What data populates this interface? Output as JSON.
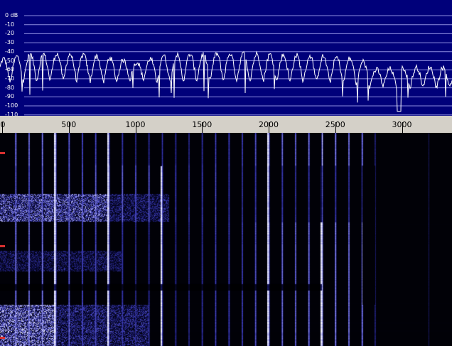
{
  "window": {
    "title": ""
  },
  "spectrum": {
    "db_labels": [
      "0 dB",
      "-10",
      "-20",
      "-30",
      "-40",
      "-50",
      "-60",
      "-70",
      "-80",
      "-90",
      "-100",
      "-110"
    ],
    "grid_color": "#8c8ce0",
    "background": "#00007a",
    "trace_color": "#ffffff"
  },
  "ruler": {
    "labels": [
      "0",
      "500",
      "1000",
      "1500",
      "2000",
      "2500",
      "3000"
    ],
    "background": "#d4d0c8"
  },
  "waterfall": {
    "palette": [
      "#000000",
      "#0a0a40",
      "#3c3cb4",
      "#9c9cf0",
      "#ffffff"
    ],
    "marker_color": "#d83030",
    "strong_lines_hz": [
      390,
      790,
      1190,
      1990,
      2390
    ],
    "segments": [
      "segment-1",
      "segment-2",
      "segment-3"
    ]
  },
  "chart_data": {
    "type": "line",
    "title": "",
    "xlabel": "",
    "ylabel": "",
    "xlim": [
      0,
      3400
    ],
    "ylim": [
      -110,
      0
    ],
    "x_ticks": [
      0,
      500,
      1000,
      1500,
      2000,
      2500,
      3000
    ],
    "y_ticks": [
      0,
      -10,
      -20,
      -30,
      -40,
      -50,
      -60,
      -70,
      -80,
      -90,
      -100,
      -110
    ],
    "grid": true,
    "series": [
      {
        "x": [
          0,
          200,
          400,
          600,
          800,
          1000,
          1200,
          1400,
          1600,
          1800,
          2000,
          2200,
          2400,
          2600,
          2750,
          2800,
          3000,
          3200,
          3400
        ],
        "y_peaks": [
          -48,
          -43,
          -42,
          -43,
          -46,
          -52,
          -44,
          -43,
          -42,
          -42,
          -43,
          -44,
          -45,
          -47,
          -52,
          -60,
          -58,
          -57,
          -58
        ],
        "y_troughs": [
          -75,
          -72,
          -72,
          -73,
          -75,
          -70,
          -74,
          -72,
          -72,
          -72,
          -73,
          -74,
          -74,
          -75,
          -80,
          -78,
          -80,
          -80,
          -80
        ]
      }
    ]
  }
}
